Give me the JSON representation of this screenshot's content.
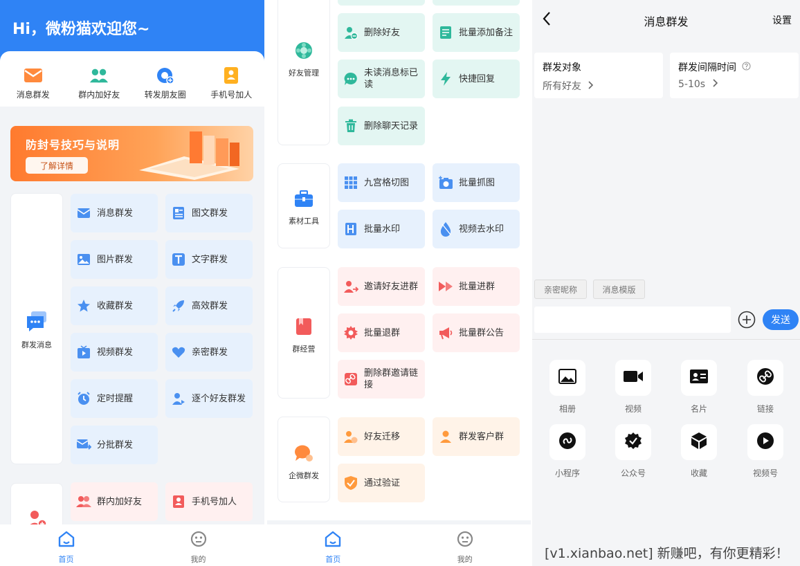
{
  "panel1": {
    "greeting": "Hi，微粉猫欢迎您~",
    "quick_actions": [
      {
        "label": "消息群发",
        "icon": "mail-icon"
      },
      {
        "label": "群内加好友",
        "icon": "group-users-icon"
      },
      {
        "label": "转发朋友圈",
        "icon": "moments-share-icon"
      },
      {
        "label": "手机号加人",
        "icon": "contact-card-icon"
      }
    ],
    "banner": {
      "title": "防封号技巧与说明",
      "button": "了解详情"
    },
    "category_broadcast": {
      "label": "群发消息",
      "icon": "chat-bubble-icon"
    },
    "tiles": [
      "消息群发",
      "图文群发",
      "图片群发",
      "文字群发",
      "收藏群发",
      "高效群发",
      "视频群发",
      "亲密群发",
      "定时提醒",
      "逐个好友群发",
      "分批群发",
      "群内加好友",
      "手机号加人"
    ],
    "nav": [
      {
        "label": "首页",
        "icon": "home-icon"
      },
      {
        "label": "我的",
        "icon": "profile-face-icon"
      }
    ]
  },
  "panel2": {
    "categories": [
      {
        "label": "好友管理",
        "icon": "gear-flower-icon"
      },
      {
        "label": "素材工具",
        "icon": "toolbox-icon"
      },
      {
        "label": "群经营",
        "icon": "book-icon"
      },
      {
        "label": "企微群发",
        "icon": "wecom-chat-icon"
      }
    ],
    "tiles": [
      "删除好友",
      "批量添加备注",
      "未读消息标已读",
      "快捷回复",
      "删除聊天记录",
      "九宫格切图",
      "批量抓图",
      "批量水印",
      "视频去水印",
      "邀请好友进群",
      "批量进群",
      "批量退群",
      "批量群公告",
      "删除群邀请链接",
      "好友迁移",
      "群发客户群",
      "通过验证"
    ],
    "nav": [
      {
        "label": "首页",
        "icon": "home-icon"
      },
      {
        "label": "我的",
        "icon": "profile-face-icon"
      }
    ]
  },
  "panel3": {
    "title": "消息群发",
    "settings": "设置",
    "target_label": "群发对象",
    "target_value": "所有好友",
    "interval_label": "群发间隔时间",
    "interval_value": "5-10s",
    "chips": [
      "亲密昵称",
      "消息模版"
    ],
    "input_placeholder": "",
    "send": "发送",
    "attachments": [
      {
        "label": "相册",
        "icon": "photo-icon"
      },
      {
        "label": "视频",
        "icon": "video-camera-icon"
      },
      {
        "label": "名片",
        "icon": "business-card-icon"
      },
      {
        "label": "链接",
        "icon": "link-icon"
      },
      {
        "label": "小程序",
        "icon": "mini-program-icon"
      },
      {
        "label": "公众号",
        "icon": "verified-badge-icon"
      },
      {
        "label": "收藏",
        "icon": "cube-icon"
      },
      {
        "label": "视频号",
        "icon": "play-circle-icon"
      }
    ]
  },
  "watermark": "[v1.xianbao.net] 新赚吧，有你更精彩！",
  "colors": {
    "primary": "#2f83f5",
    "green_tile": "#e3f6f2",
    "blue_tile": "#e7f1fd",
    "red_tile": "#fff0f0",
    "orange_tile": "#fff3e8"
  }
}
